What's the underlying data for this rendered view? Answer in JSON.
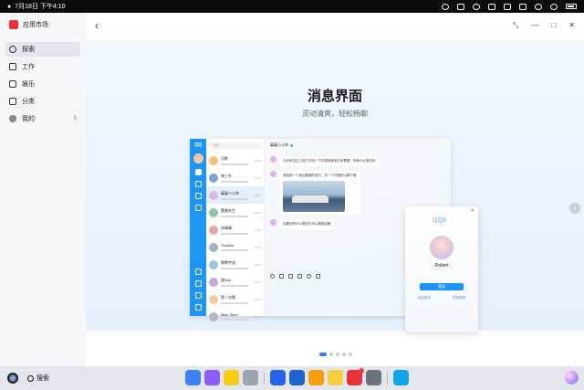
{
  "statusbar": {
    "time": "7月18日 下午4:10"
  },
  "app": {
    "title": "应用市场"
  },
  "sidebar": {
    "items": [
      {
        "label": "探索",
        "icon": "compass-icon",
        "active": true
      },
      {
        "label": "工作",
        "icon": "work-icon"
      },
      {
        "label": "娱乐",
        "icon": "entertainment-icon"
      },
      {
        "label": "分类",
        "icon": "category-icon"
      },
      {
        "label": "我的",
        "icon": "avatar-icon",
        "count": "5"
      }
    ]
  },
  "hero": {
    "title": "消息界面",
    "subtitle": "灵动清爽，轻松畅聊"
  },
  "qq": {
    "logo": "QQ",
    "search_placeholder": "搜索",
    "contacts": [
      {
        "name": "沉默",
        "time": "10:50",
        "color": "#f3c27a"
      },
      {
        "name": "林三叶",
        "time": "10:48",
        "color": "#7aa5d8"
      },
      {
        "name": "蔓蔓小公举",
        "time": "10:47",
        "color": "#d9b8e8",
        "active": true
      },
      {
        "name": "董澈先生",
        "time": "10:46",
        "color": "#8ec3a7"
      },
      {
        "name": "徐晴晴",
        "time": "10:40",
        "color": "#e8a7a7"
      },
      {
        "name": "Thomas",
        "time": "10:30",
        "color": "#a3b4c9"
      },
      {
        "name": "嗯嗯宇宙",
        "time": "10:20",
        "color": "#9cc4e4"
      },
      {
        "name": "星Ado",
        "time": "10:12",
        "color": "#c7a7e0"
      },
      {
        "name": "第一次哦",
        "time": "10:05",
        "color": "#f0c9a0"
      },
      {
        "name": "Miss Shen",
        "time": "09:55",
        "color": "#b0b8c4"
      }
    ],
    "chat": {
      "title": "蔓蔓小公举",
      "messages": [
        "今天来这边上班打卡啦～下次带我家宝贝来看看，你有什么想法吗",
        "我找到一个适合露营的地方，在一个环湖的山脚下面",
        "如果你有什么想去也可以跟我说哦"
      ]
    }
  },
  "profile_card": {
    "logo": "QQ9",
    "name": "Robert",
    "button": "登录",
    "links": [
      "添加账号",
      "扫码登录"
    ]
  },
  "pager": {
    "count": 5,
    "active": 0
  },
  "taskbar": {
    "search_label": "搜索",
    "apps": [
      {
        "name": "launcher-icon",
        "color": "#3b82f6"
      },
      {
        "name": "app-store-icon",
        "color": "#8b5cf6"
      },
      {
        "name": "notes-icon",
        "color": "#facc15"
      },
      {
        "name": "trash-icon",
        "color": "#9ca3af"
      },
      {
        "name": "browser-icon",
        "color": "#2563eb"
      },
      {
        "name": "mail-icon",
        "color": "#1e64d0"
      },
      {
        "name": "gallery-icon",
        "color": "#f59e0b"
      },
      {
        "name": "calendar-icon",
        "color": "#f4d03f"
      },
      {
        "name": "app-market-icon",
        "color": "#e8323c",
        "badge": true
      },
      {
        "name": "settings-icon",
        "color": "#6b7280"
      },
      {
        "name": "files-icon",
        "color": "#0ea5e9"
      }
    ]
  }
}
